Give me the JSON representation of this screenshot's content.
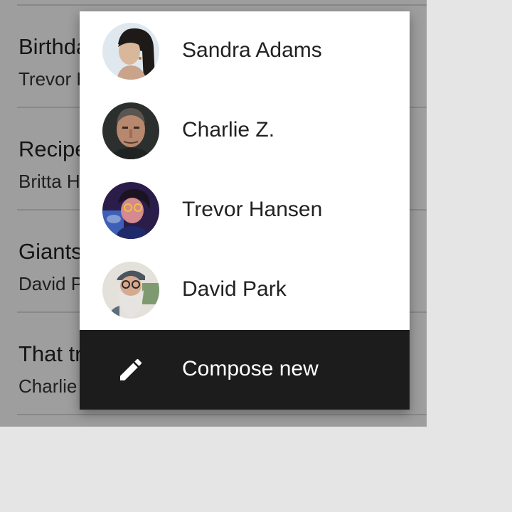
{
  "background_list": [
    {
      "title": "Birthday gift",
      "subtitle": "Trevor Hansen"
    },
    {
      "title": "Recipe to try",
      "subtitle": "Britta Holt"
    },
    {
      "title": "Giants game",
      "subtitle": "David Park"
    },
    {
      "title": "That trip",
      "subtitle": "Charlie Z."
    }
  ],
  "menu": {
    "items": [
      {
        "label": "Sandra Adams",
        "avatar": "woman-avatar"
      },
      {
        "label": "Charlie Z.",
        "avatar": "older-man-avatar"
      },
      {
        "label": "Trevor Hansen",
        "avatar": "young-man-avatar"
      },
      {
        "label": "David Park",
        "avatar": "bearded-man-avatar"
      }
    ],
    "compose": {
      "label": "Compose new",
      "icon": "pencil-icon"
    }
  },
  "colors": {
    "scrim": "#000000",
    "menu_bg": "#ffffff",
    "compose_bg": "#1c1c1c",
    "page_bg": "#e5e5e5"
  }
}
